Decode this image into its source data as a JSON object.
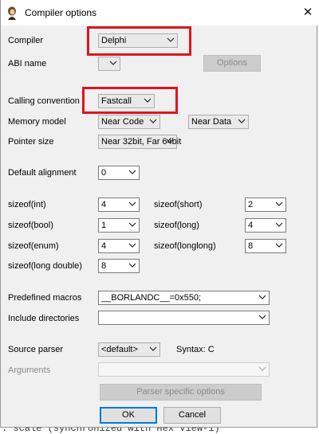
{
  "window": {
    "title": "Compiler options",
    "close_glyph": "✕"
  },
  "labels": {
    "compiler": "Compiler",
    "abi_name": "ABI name",
    "calling_convention": "Calling convention",
    "memory_model": "Memory model",
    "pointer_size": "Pointer size",
    "default_alignment": "Default alignment",
    "sizeof_int": "sizeof(int)",
    "sizeof_short": "sizeof(short)",
    "sizeof_bool": "sizeof(bool)",
    "sizeof_long": "sizeof(long)",
    "sizeof_enum": "sizeof(enum)",
    "sizeof_longlong": "sizeof(longlong)",
    "sizeof_long_double": "sizeof(long double)",
    "predefined_macros": "Predefined macros",
    "include_directories": "Include directories",
    "source_parser": "Source parser",
    "syntax": "Syntax:  C",
    "arguments": "Arguments"
  },
  "values": {
    "compiler": "Delphi",
    "abi_name": "",
    "calling_convention": "Fastcall",
    "memory_model_code": "Near Code",
    "memory_model_data": "Near Data",
    "pointer_size": "Near 32bit, Far 64bit",
    "default_alignment": "0",
    "sizeof_int": "4",
    "sizeof_short": "2",
    "sizeof_bool": "1",
    "sizeof_long": "4",
    "sizeof_enum": "4",
    "sizeof_longlong": "8",
    "sizeof_long_double": "8",
    "predefined_macros": "__BORLANDC__=0x550;",
    "include_directories": "",
    "source_parser": "<default>",
    "arguments": ""
  },
  "buttons": {
    "options": "Options",
    "parser_specific": "Parser specific options",
    "ok": "OK",
    "cancel": "Cancel"
  },
  "background_text": ": scale (synchronized with Hex View-1)",
  "colors": {
    "highlight": "#e0141e",
    "default_button": "#0078d7"
  }
}
